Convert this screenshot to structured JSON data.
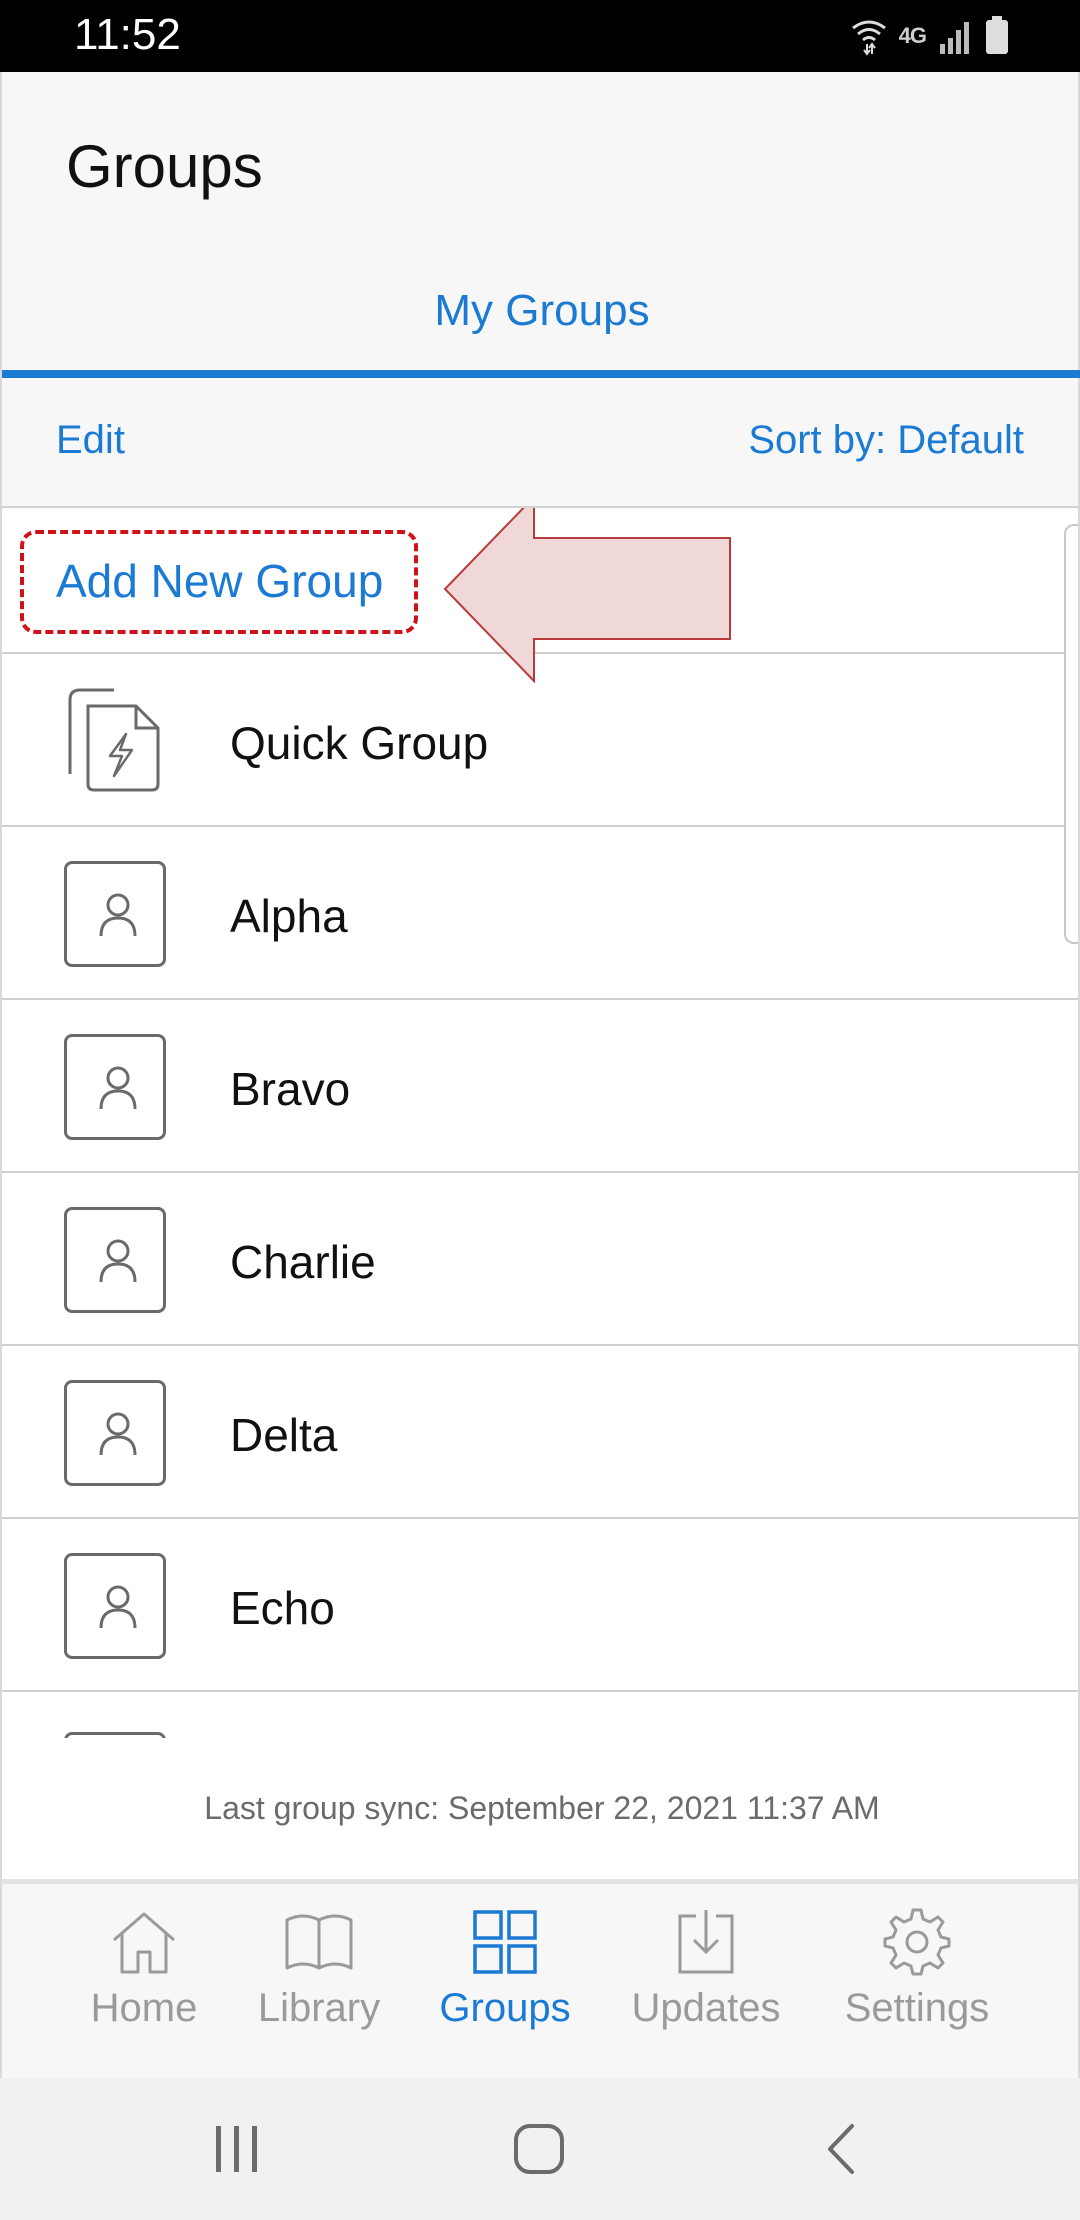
{
  "status_bar": {
    "time": "11:52",
    "network_label": "4G",
    "icons": [
      "wifi-icon",
      "network-icon",
      "signal-icon",
      "battery-icon"
    ]
  },
  "header": {
    "title": "Groups"
  },
  "tabs": [
    {
      "label": "My Groups",
      "active": true
    }
  ],
  "toolbar": {
    "edit_label": "Edit",
    "sort_label": "Sort by: Default"
  },
  "list": {
    "add_label": "Add New Group",
    "groups": [
      {
        "name": "Quick Group",
        "icon": "quick-group-icon"
      },
      {
        "name": "Alpha",
        "icon": "person-icon"
      },
      {
        "name": "Bravo",
        "icon": "person-icon"
      },
      {
        "name": "Charlie",
        "icon": "person-icon"
      },
      {
        "name": "Delta",
        "icon": "person-icon"
      },
      {
        "name": "Echo",
        "icon": "person-icon"
      }
    ]
  },
  "sync": {
    "text": "Last group sync: September 22, 2021 11:37 AM"
  },
  "bottom_nav": {
    "items": [
      {
        "label": "Home",
        "icon": "home-icon",
        "active": false
      },
      {
        "label": "Library",
        "icon": "book-icon",
        "active": false
      },
      {
        "label": "Groups",
        "icon": "grid-icon",
        "active": true
      },
      {
        "label": "Updates",
        "icon": "download-icon",
        "active": false
      },
      {
        "label": "Settings",
        "icon": "gear-icon",
        "active": false
      }
    ]
  },
  "colors": {
    "accent": "#1a7ad4",
    "highlight": "#d0111a",
    "arrow_fill": "#f0d8d8",
    "arrow_stroke": "#b83a3a"
  }
}
